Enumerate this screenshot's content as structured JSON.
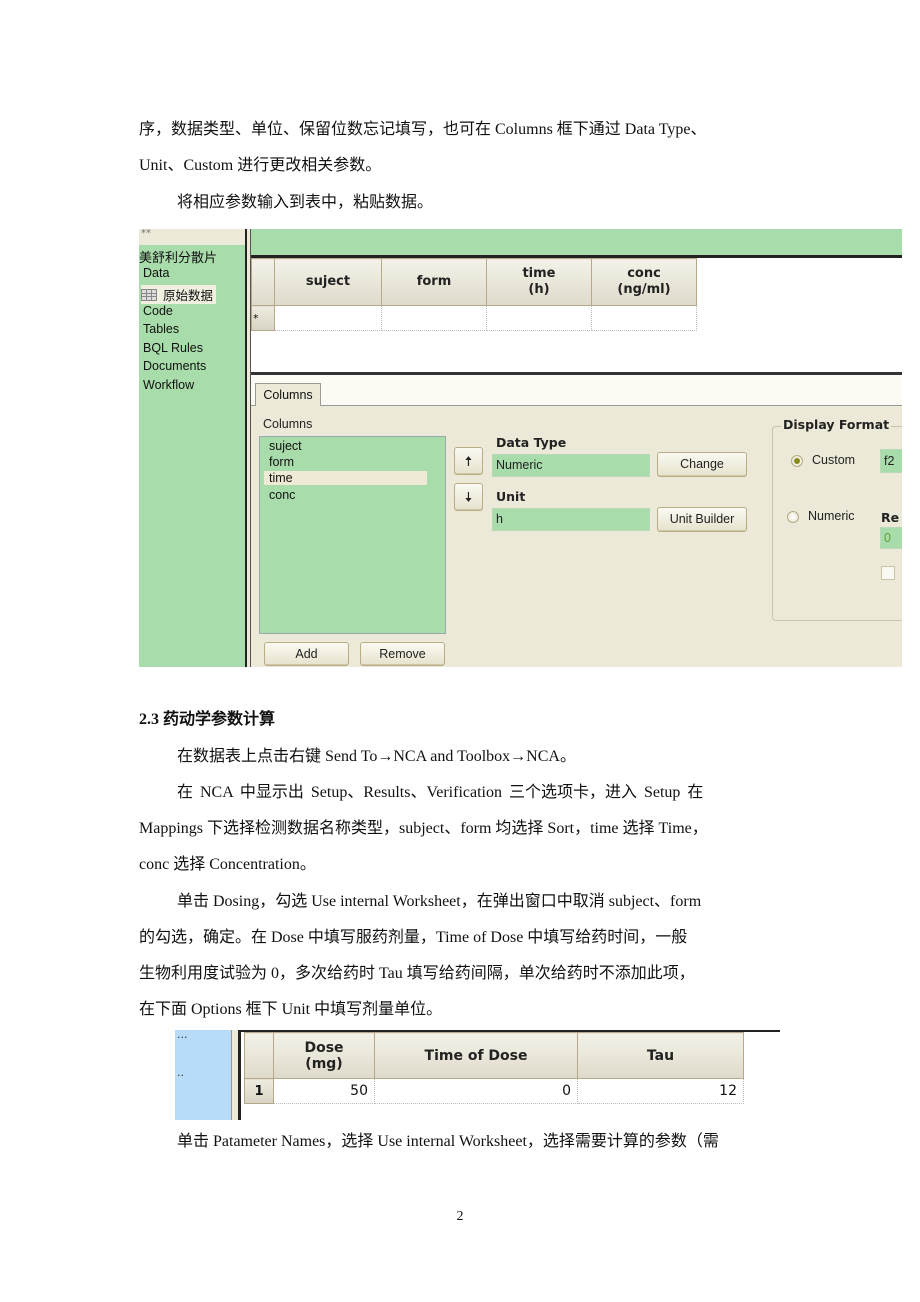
{
  "paragraphs": {
    "p1": "序，数据类型、单位、保留位数忘记填写，也可在 Columns 框下通过 Data Type、",
    "p1b": "Unit、Custom 进行更改相关参数。",
    "p2": "将相应参数输入到表中，粘贴数据。",
    "section_heading": "2.3 药动学参数计算",
    "p3": "在数据表上点击右键 Send To→NCA and Toolbox→NCA。",
    "p4a": "在 NCA 中显示出 Setup、Results、Verification 三个选项卡，进入 Setup 在",
    "p4b": "Mappings 下选择检测数据名称类型，subject、form 均选择 Sort，time 选择 Time，",
    "p4c": "conc 选择 Concentration。",
    "p5a": "单击 Dosing，勾选 Use internal Worksheet，在弹出窗口中取消 subject、form",
    "p5b": "的勾选，确定。在 Dose 中填写服药剂量，Time of Dose 中填写给药时间，一般",
    "p5c": "生物利用度试验为 0，多次给药时 Tau 填写给药间隔，单次给药时不添加此项，",
    "p5d": "在下面 Options 框下 Unit 中填写剂量单位。",
    "p6": "单击 Patameter Names，选择 Use internal Worksheet，选择需要计算的参数（需"
  },
  "screenshot1": {
    "nav": {
      "project": "美舒利分散片",
      "items": [
        {
          "label": "Data",
          "icon": null
        },
        {
          "label": "原始数据",
          "icon": "worksheet-grid-icon",
          "selected": true
        },
        {
          "label": "Code"
        },
        {
          "label": "Tables"
        },
        {
          "label": "BQL Rules"
        },
        {
          "label": "Documents"
        },
        {
          "label": "Workflow"
        }
      ]
    },
    "worksheet": {
      "columns": [
        "suject",
        "form",
        "time\n(h)",
        "conc\n(ng/ml)"
      ],
      "col_lines": [
        [
          "suject"
        ],
        [
          "form"
        ],
        [
          "time",
          "(h)"
        ],
        [
          "conc",
          "(ng/ml)"
        ]
      ],
      "new_row_marker": "*"
    },
    "tab": "Columns",
    "columns_panel": {
      "label": "Columns",
      "items": [
        "suject",
        "form",
        "time",
        "conc"
      ],
      "selected": "time",
      "add_label": "Add",
      "remove_label": "Remove",
      "move_up_icon": "arrow-up-icon",
      "move_down_icon": "arrow-down-icon"
    },
    "data_type": {
      "label": "Data Type",
      "value": "Numeric",
      "button": "Change"
    },
    "unit": {
      "label": "Unit",
      "value": "h",
      "button": "Unit Builder"
    },
    "display_format": {
      "label": "Display Format",
      "custom_label": "Custom",
      "custom_value": "f2",
      "custom_selected": true,
      "numeric_label": "Numeric",
      "numeric_selected": false,
      "partial_label": "Re",
      "partial_value": "0"
    },
    "colors": {
      "green": "#a8dcaa",
      "panel": "#ece9d8"
    }
  },
  "screenshot2": {
    "side_dots": [
      "...",
      ".."
    ],
    "columns": [
      [
        "Dose",
        "(mg)"
      ],
      [
        "Time of Dose"
      ],
      [
        "Tau"
      ]
    ],
    "rows": [
      {
        "index": "1",
        "dose": "50",
        "time_of_dose": "0",
        "tau": "12"
      }
    ]
  },
  "page_number": "2"
}
